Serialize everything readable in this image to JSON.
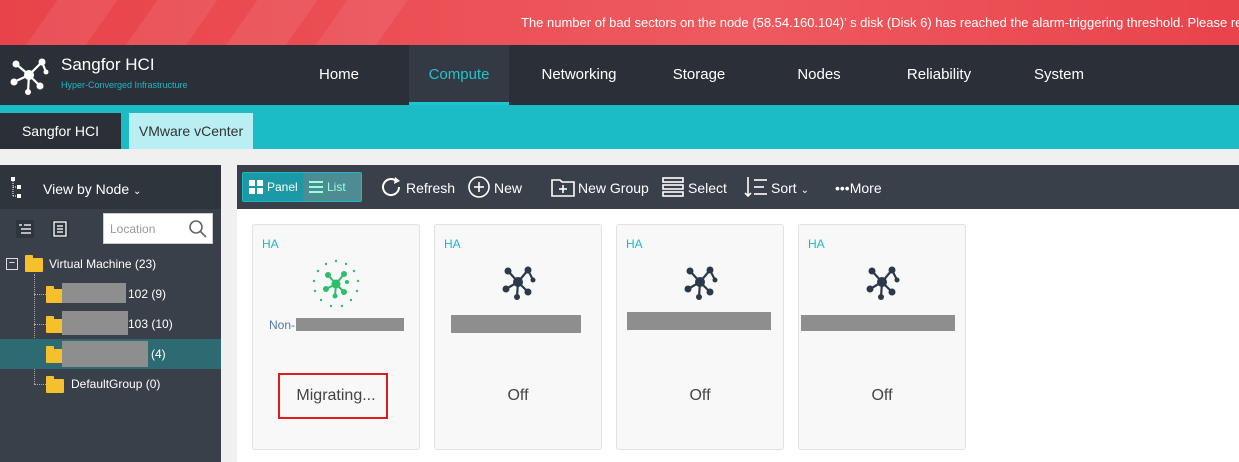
{
  "alarm": {
    "text": "The number of bad sectors on the node (58.54.160.104)’ s disk (Disk 6) has reached the alarm-triggering threshold. Please re"
  },
  "brand": {
    "title": "Sangfor HCI",
    "subtitle": "Hyper-Converged Infrastructure"
  },
  "nav": {
    "items": [
      "Home",
      "Compute",
      "Networking",
      "Storage",
      "Nodes",
      "Reliability",
      "System"
    ],
    "active": "Compute"
  },
  "tabs": [
    "Sangfor HCI",
    "VMware vCenter"
  ],
  "left": {
    "view_by": "View by Node",
    "search_placeholder": "Location",
    "tree": {
      "root": "Virtual Machine (23)",
      "children": [
        {
          "suffix": "102 (9)"
        },
        {
          "suffix": "103 (10)"
        },
        {
          "suffix": "(4)"
        },
        {
          "suffix": "DefaultGroup (0)"
        }
      ]
    }
  },
  "toolbar": {
    "panel_label": "Panel",
    "list_label": "List",
    "refresh": "Refresh",
    "new": "New",
    "new_group": "New Group",
    "select": "Select",
    "sort": "Sort",
    "more": "•••More"
  },
  "cards": [
    {
      "badge": "HA",
      "name_prefix": "Non-",
      "status": "Migrating..."
    },
    {
      "badge": "HA",
      "status": "Off"
    },
    {
      "badge": "HA",
      "status": "Off"
    },
    {
      "badge": "HA",
      "status": "Off"
    }
  ],
  "colors": {
    "accent": "#1bbcc6",
    "nav_bg": "#2b3038",
    "alarm_red": "#e8434a",
    "highlight_red": "#e01b1b",
    "vm_icon_dark": "#2b3a4a",
    "vm_icon_migrating": "#2bbf6a"
  }
}
